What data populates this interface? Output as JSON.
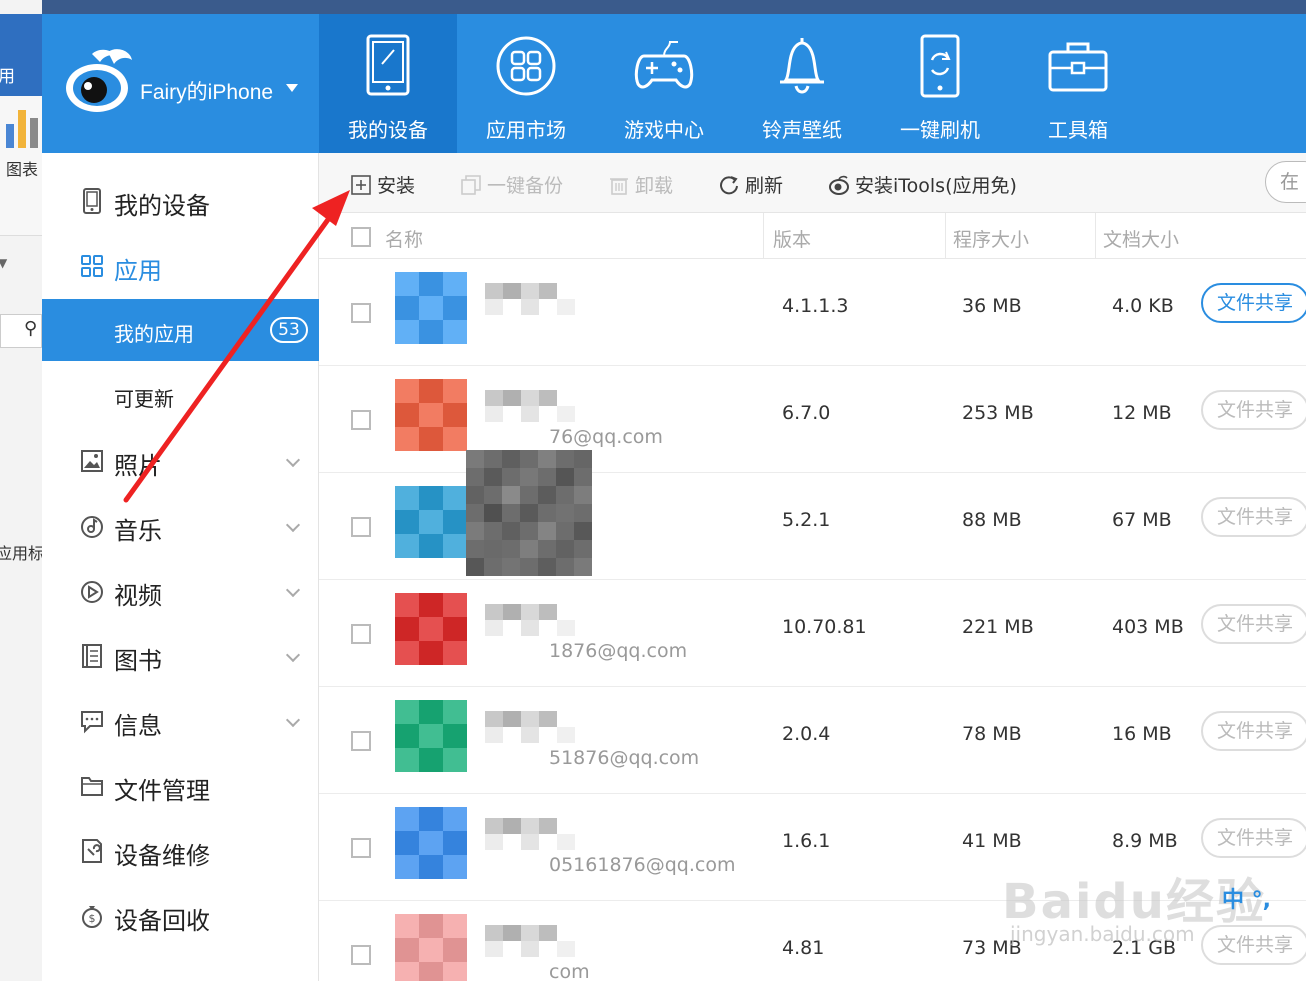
{
  "background_app": {
    "label_top": "用",
    "label_chart": "图表",
    "label_side": "应用标"
  },
  "header": {
    "device_name": "Fairy的iPhone",
    "tabs": [
      {
        "label": "我的设备",
        "icon": "tablet-icon",
        "active": true
      },
      {
        "label": "应用市场",
        "icon": "app-grid-icon",
        "active": false
      },
      {
        "label": "游戏中心",
        "icon": "gamepad-icon",
        "active": false
      },
      {
        "label": "铃声壁纸",
        "icon": "bell-icon",
        "active": false
      },
      {
        "label": "一键刷机",
        "icon": "phone-refresh-icon",
        "active": false
      },
      {
        "label": "工具箱",
        "icon": "toolbox-icon",
        "active": false
      }
    ]
  },
  "sidebar": {
    "items": [
      {
        "label": "我的设备",
        "icon": "device-icon"
      },
      {
        "label": "应用",
        "icon": "apps-icon"
      },
      {
        "label": "我的应用",
        "badge": "53"
      },
      {
        "label": "可更新"
      },
      {
        "label": "照片",
        "icon": "photo-icon"
      },
      {
        "label": "音乐",
        "icon": "music-icon"
      },
      {
        "label": "视频",
        "icon": "video-icon"
      },
      {
        "label": "图书",
        "icon": "book-icon"
      },
      {
        "label": "信息",
        "icon": "message-icon"
      },
      {
        "label": "文件管理",
        "icon": "folder-icon"
      },
      {
        "label": "设备维修",
        "icon": "repair-icon"
      },
      {
        "label": "设备回收",
        "icon": "recycle-icon"
      }
    ]
  },
  "toolbar": {
    "install": "安装",
    "backup": "一键备份",
    "uninstall": "卸载",
    "refresh": "刷新",
    "install_itools": "安装iTools(应用免)",
    "search_placeholder": "在"
  },
  "table": {
    "columns": {
      "name": "名称",
      "version": "版本",
      "program_size": "程序大小",
      "doc_size": "文档大小"
    },
    "share_label": "文件共享",
    "rows": [
      {
        "version": "4.1.1.3",
        "program_size": "36 MB",
        "doc_size": "4.0 KB",
        "account": "",
        "share_enabled": true,
        "icon_color": "#3f9ff5"
      },
      {
        "version": "6.7.0",
        "program_size": "253 MB",
        "doc_size": "12 MB",
        "account": "76@qq.com",
        "share_enabled": false,
        "icon_color": "#f06040"
      },
      {
        "version": "5.2.1",
        "program_size": "88 MB",
        "doc_size": "67 MB",
        "account": "",
        "share_enabled": false,
        "icon_color": "#2a9fd6"
      },
      {
        "version": "10.70.81",
        "program_size": "221 MB",
        "doc_size": "403 MB",
        "account": "1876@qq.com",
        "share_enabled": false,
        "icon_color": "#e02a2a"
      },
      {
        "version": "2.0.4",
        "program_size": "78 MB",
        "doc_size": "16 MB",
        "account": "51876@qq.com",
        "share_enabled": false,
        "icon_color": "#18b07a"
      },
      {
        "version": "1.6.1",
        "program_size": "41 MB",
        "doc_size": "8.9 MB",
        "account": "05161876@qq.com",
        "share_enabled": false,
        "icon_color": "#3a8ff0"
      },
      {
        "version": "4.81",
        "program_size": "73 MB",
        "doc_size": "2.1 GB",
        "account": "com",
        "share_enabled": false,
        "icon_color": "#f4a0a0"
      }
    ]
  },
  "watermark": {
    "text": "Baidu经验",
    "url": "jingyan.baidu.com"
  },
  "ime_indicator": "中 °,",
  "colors": {
    "brand_blue": "#2a8de0",
    "active_tab": "#1977cc",
    "arrow_red": "#ee2222"
  }
}
